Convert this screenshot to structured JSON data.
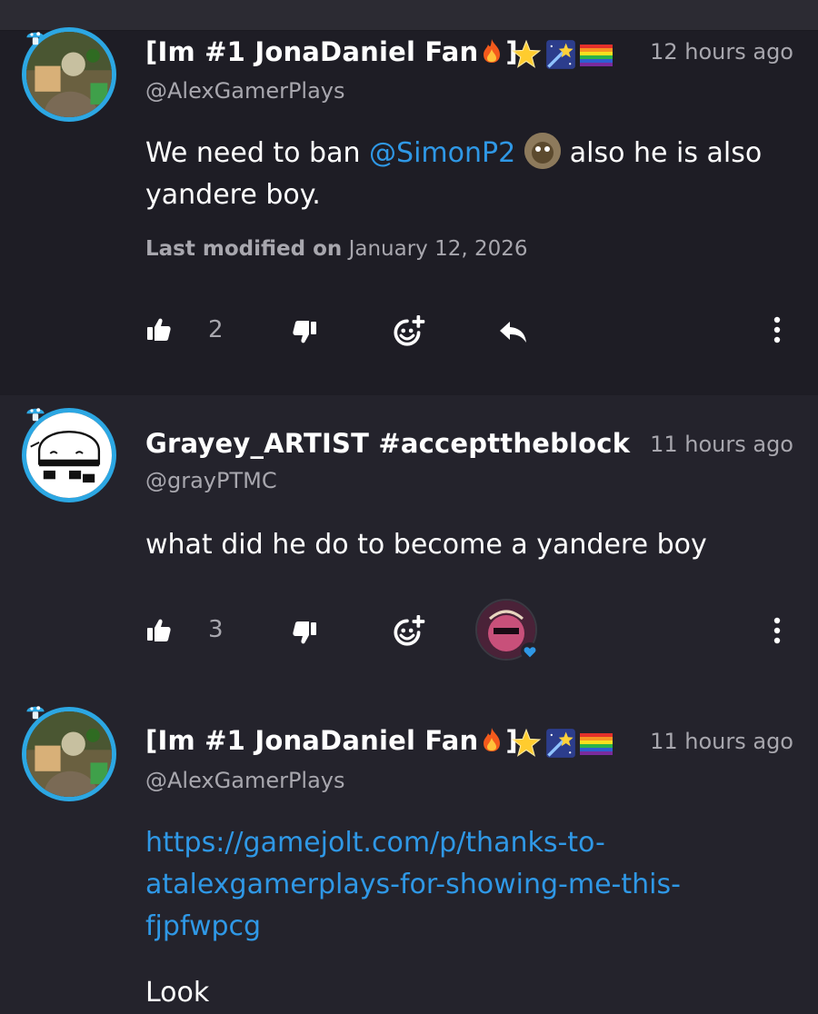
{
  "comments": [
    {
      "display_name": "[Im #1 JonaDaniel Fan",
      "name_bracket": "]",
      "handle": "@AlexGamerPlays",
      "time": "12 hours ago",
      "text_before": "We need to ban ",
      "mention": "@SimonP2",
      "text_after": " also he is also yandere boy.",
      "modified_label": "Last modified on",
      "modified_date": "January 12, 2026",
      "likes": "2"
    },
    {
      "display_name": "Grayey_ARTIST #accepttheblock",
      "handle": "@grayPTMC",
      "time": "11 hours ago",
      "text": "what did he do to become a yandere boy",
      "likes": "3"
    },
    {
      "display_name": "[Im #1 JonaDaniel Fan",
      "name_bracket": "]",
      "handle": "@AlexGamerPlays",
      "time": "11 hours ago",
      "link": "https://gamejolt.com/p/thanks-to-atalexgamerplays-for-showing-me-this-fjpfwpcg",
      "link_line1": "https://gamejolt.com/p/thanks-to-",
      "link_line2": "atalexgamerplays-for-showing-me-this-",
      "link_line3": "fjpfwpcg",
      "text_partial": "Look"
    }
  ],
  "icons": {
    "like": "thumbs-up-icon",
    "dislike": "thumbs-down-icon",
    "react": "add-reaction-icon",
    "reply": "reply-icon",
    "more": "more-vertical-icon",
    "fire": "fire-emoji",
    "star": "glowing-star-emoji",
    "shooting_star": "shooting-star-emoji",
    "rainbow": "rainbow-flag-emoji",
    "heart": "heart-icon"
  },
  "colors": {
    "background": "#24232c",
    "highlight_background": "#1e1d25",
    "accent_link": "#2f98e6",
    "avatar_ring": "#2ca7e3",
    "muted_text": "#a8a7ae"
  }
}
